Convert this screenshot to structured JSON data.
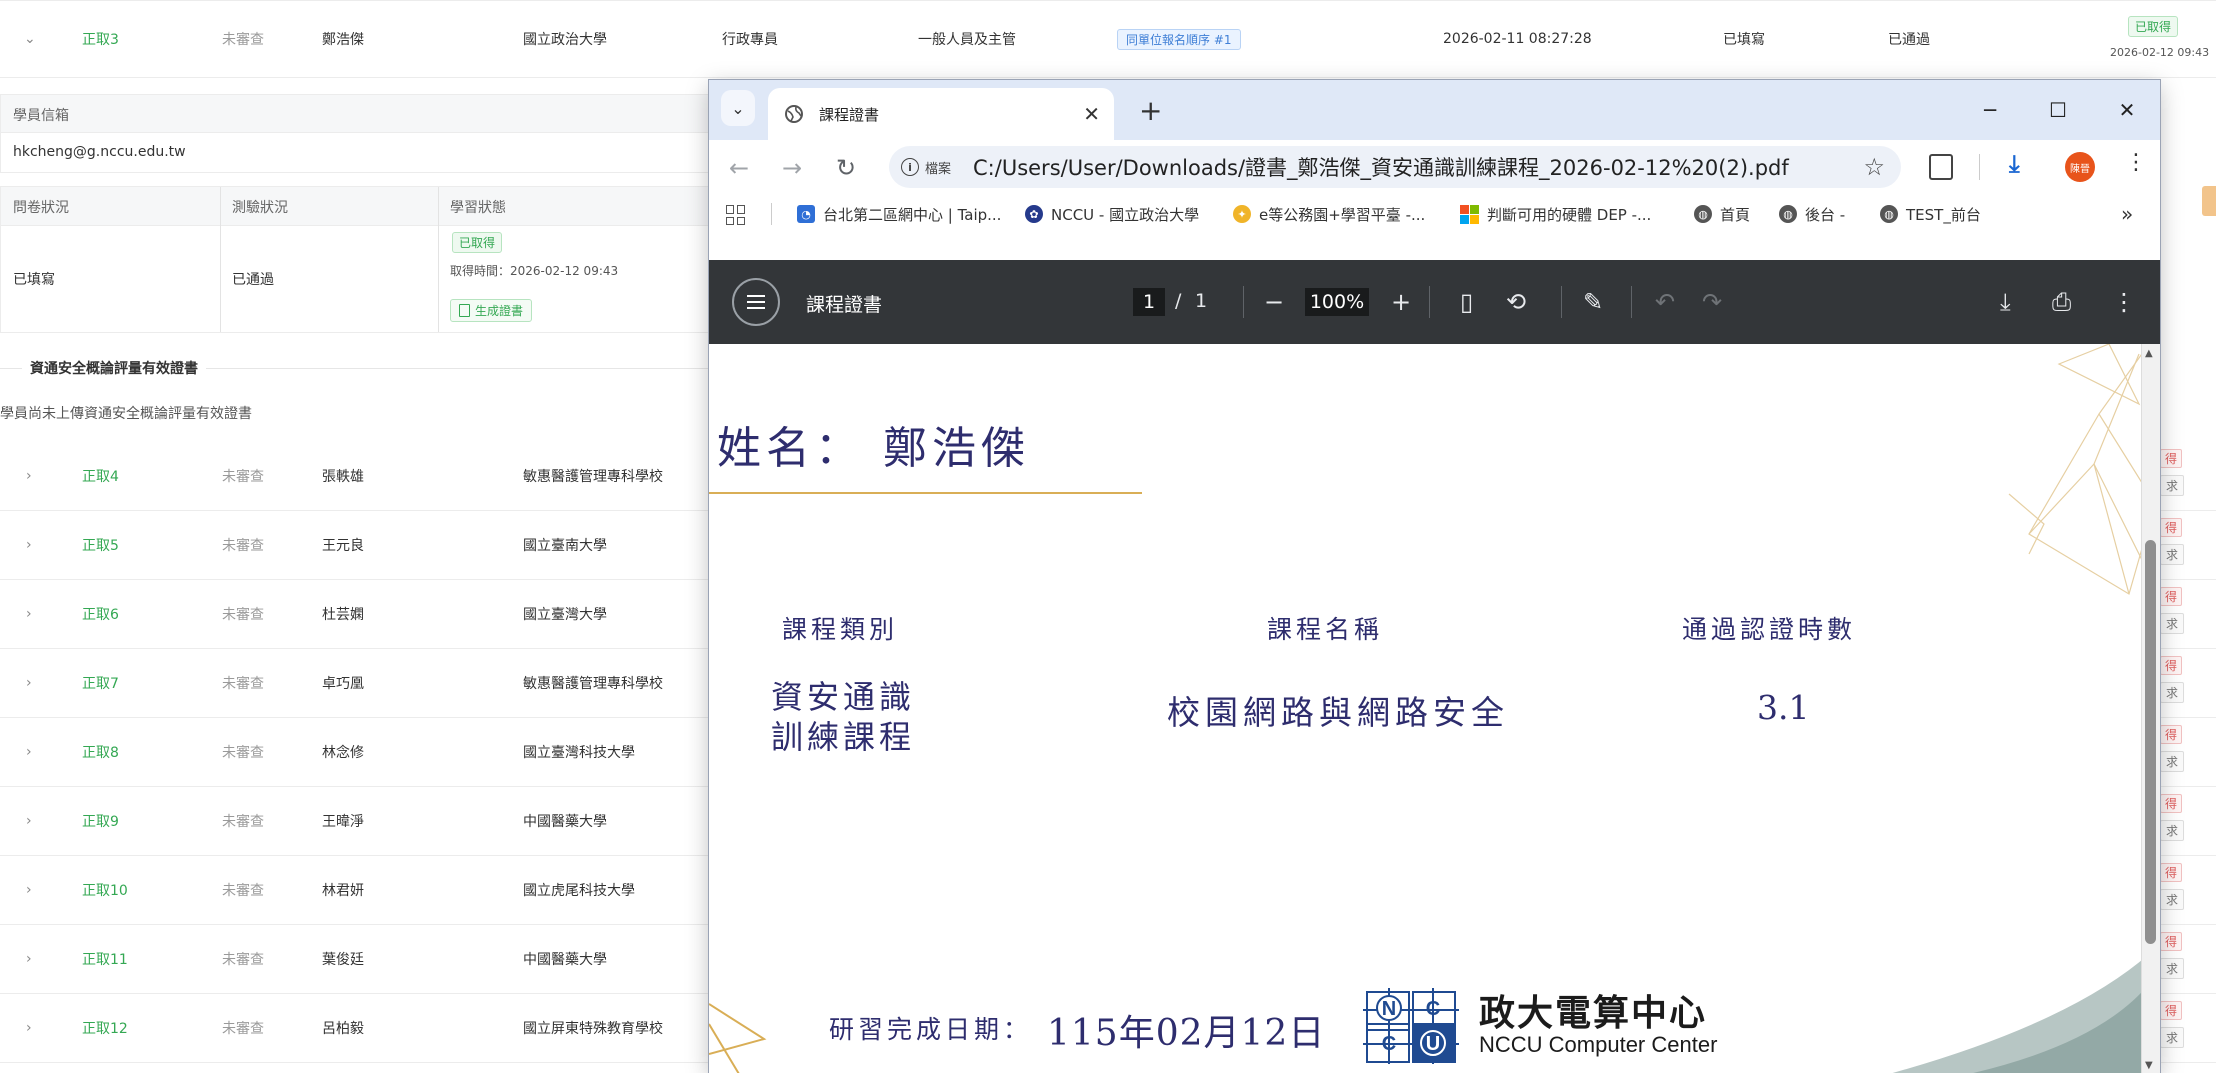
{
  "table": {
    "top_row": {
      "status": "正取3",
      "review": "未審查",
      "name": "鄭浩傑",
      "school": "國立政治大學",
      "position": "行政專員",
      "category": "一般人員及主管",
      "tag": "同單位報名順序 #1",
      "time": "2026-02-11 08:27:28",
      "questionnaire": "已填寫",
      "test": "已通過",
      "obtained_tag": "已取得",
      "obtained_time": "2026-02-12 09:43"
    },
    "email_label": "學員信箱",
    "email_value": "hkcheng@g.nccu.edu.tw",
    "status_headers": [
      "問卷狀況",
      "測驗狀況",
      "學習狀態"
    ],
    "status_values": {
      "questionnaire": "已填寫",
      "test": "已通過",
      "learning_tag": "已取得",
      "obtained_time": "取得時間：2026-02-12 09:43",
      "generate_btn": "生成證書"
    },
    "cert_section_title": "資通安全概論評量有效證書",
    "cert_section_note": "學員尚未上傳資通安全概論評量有效證書",
    "rows": [
      {
        "status": "正取4",
        "review": "未審查",
        "name": "張軼雄",
        "school": "敏惠醫護管理專科學校"
      },
      {
        "status": "正取5",
        "review": "未審查",
        "name": "王元良",
        "school": "國立臺南大學"
      },
      {
        "status": "正取6",
        "review": "未審查",
        "name": "杜芸嫻",
        "school": "國立臺灣大學"
      },
      {
        "status": "正取7",
        "review": "未審查",
        "name": "卓巧凰",
        "school": "敏惠醫護管理專科學校"
      },
      {
        "status": "正取8",
        "review": "未審查",
        "name": "林念修",
        "school": "國立臺灣科技大學"
      },
      {
        "status": "正取9",
        "review": "未審查",
        "name": "王暐淨",
        "school": "中國醫藥大學"
      },
      {
        "status": "正取10",
        "review": "未審查",
        "name": "林君妍",
        "school": "國立虎尾科技大學"
      },
      {
        "status": "正取11",
        "review": "未審查",
        "name": "葉俊廷",
        "school": "中國醫藥大學"
      },
      {
        "status": "正取12",
        "review": "未審查",
        "name": "呂柏毅",
        "school": "國立屏東特殊教育學校"
      }
    ],
    "right_edge_tag": "得",
    "right_edge_btn": "求"
  },
  "browser": {
    "tab_title": "課程證書",
    "address_info": "檔案",
    "url": "C:/Users/User/Downloads/證書_鄭浩傑_資安通識訓練課程_2026-02-12%20(2).pdf",
    "profile_initials": "陳晉",
    "bookmarks": [
      "台北第二區網中心 | Taip...",
      "NCCU - 國立政治大學",
      "e等公務園+學習平臺 -...",
      "判斷可用的硬體 DEP -...",
      "首頁",
      "後台 -",
      "TEST_前台"
    ]
  },
  "pdf": {
    "title": "課程證書",
    "page_current": "1",
    "page_sep": "/",
    "page_total": "1",
    "zoom": "100%",
    "name_line": "姓名：  鄭浩傑",
    "col_headers": [
      "課程類別",
      "課程名稱",
      "通過認證時數"
    ],
    "course_type_line1": "資安通識",
    "course_type_line2": "訓練課程",
    "course_name": "校園網路與網路安全",
    "hours": "3.1",
    "completion_label": "研習完成日期：",
    "completion_date": "115年02月12日",
    "org_name": "政大電算中心",
    "org_name_en": "NCCU Computer Center",
    "logo_letters": [
      "N",
      "C",
      "C",
      "U"
    ]
  }
}
